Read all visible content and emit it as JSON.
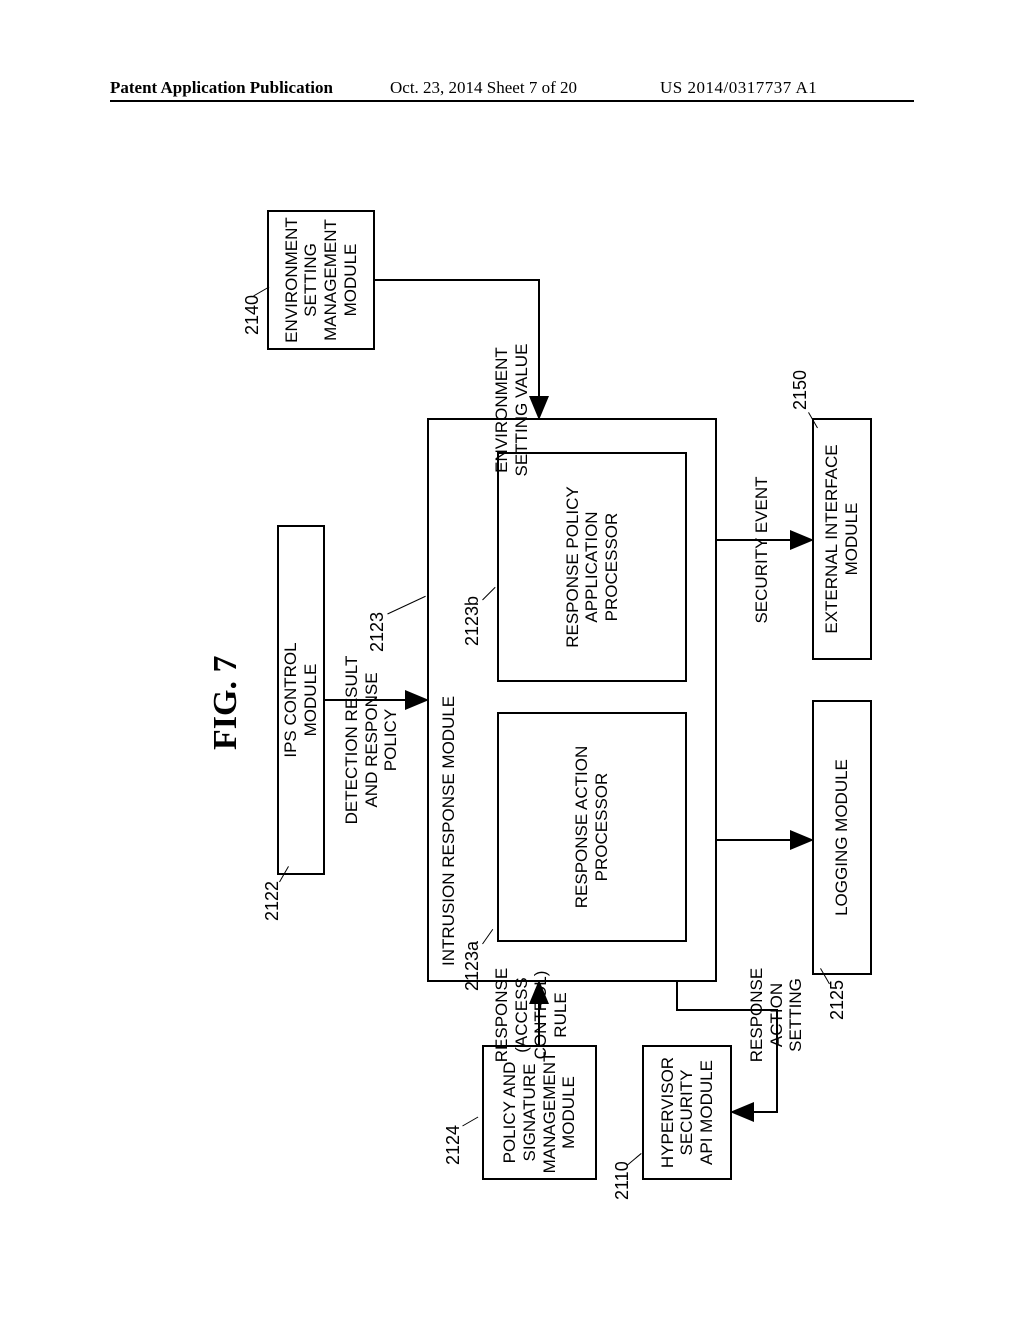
{
  "header": {
    "left": "Patent Application Publication",
    "middle": "Oct. 23, 2014  Sheet 7 of 20",
    "right": "US 2014/0317737 A1"
  },
  "figure": {
    "title": "FIG. 7",
    "refs": {
      "ips_control": "2122",
      "intrusion_response": "2123",
      "response_action_proc": "2123a",
      "response_policy_proc": "2123b",
      "policy_sig_mgmt": "2124",
      "logging": "2125",
      "hypervisor_api": "2110",
      "env_setting_mgmt": "2140",
      "external_interface": "2150"
    },
    "boxes": {
      "ips_control": "IPS CONTROL\nMODULE",
      "intrusion_response": "INTRUSION RESPONSE MODULE",
      "response_action_proc": "RESPONSE ACTION\nPROCESSOR",
      "response_policy_proc": "RESPONSE POLICY\nAPPLICATION\nPROCESSOR",
      "policy_sig_mgmt": "POLICY AND\nSIGNATURE\nMANAGEMENT\nMODULE",
      "hypervisor_api": "HYPERVISOR\nSECURITY\nAPI MODULE",
      "logging": "LOGGING MODULE",
      "external_interface": "EXTERNAL INTERFACE\nMODULE",
      "env_setting_mgmt": "ENVIRONMENT\nSETTING\nMANAGEMENT\nMODULE"
    },
    "arrow_labels": {
      "detection_result": "DETECTION RESULT\nAND RESPONSE POLICY",
      "response_rule": "RESPONSE\n(ACCESS\nCONTROL)\nRULE",
      "response_action_setting": "RESPONSE\nACTION\nSETTING",
      "env_setting_value": "ENVIRONMENT\nSETTING VALUE",
      "security_event": "SECURITY EVENT"
    }
  }
}
